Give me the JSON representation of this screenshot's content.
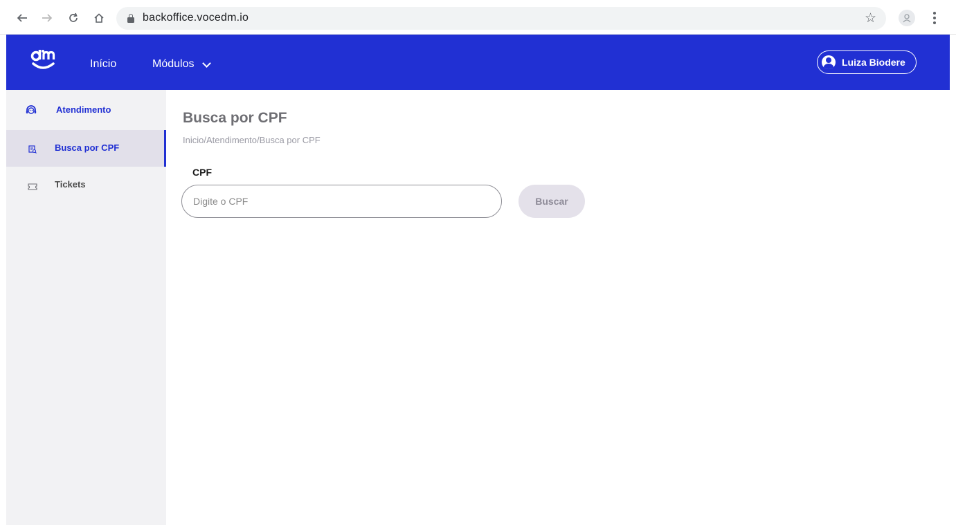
{
  "browser": {
    "url": "backoffice.vocedm.io",
    "icons": [
      "back-arrow-icon",
      "forward-arrow-icon",
      "reload-icon",
      "home-icon",
      "lock-icon",
      "star-icon",
      "profile-icon",
      "kebab-menu-icon"
    ]
  },
  "header": {
    "nav_inicio": "Início",
    "nav_modulos": "Módulos",
    "user_name": "Luiza Biodere",
    "brand_color": "#2130d3"
  },
  "sidebar": {
    "section_title": "Atendimento",
    "items": [
      {
        "label": "Busca por CPF",
        "icon": "search-document-icon",
        "active": true
      },
      {
        "label": "Tickets",
        "icon": "ticket-icon",
        "active": false
      }
    ]
  },
  "main": {
    "title": "Busca por CPF",
    "breadcrumb": "Inicio/Atendimento/Busca por CPF",
    "cpf_label": "CPF",
    "cpf_placeholder": "Digite o CPF",
    "cpf_value": "",
    "search_button": "Buscar"
  }
}
